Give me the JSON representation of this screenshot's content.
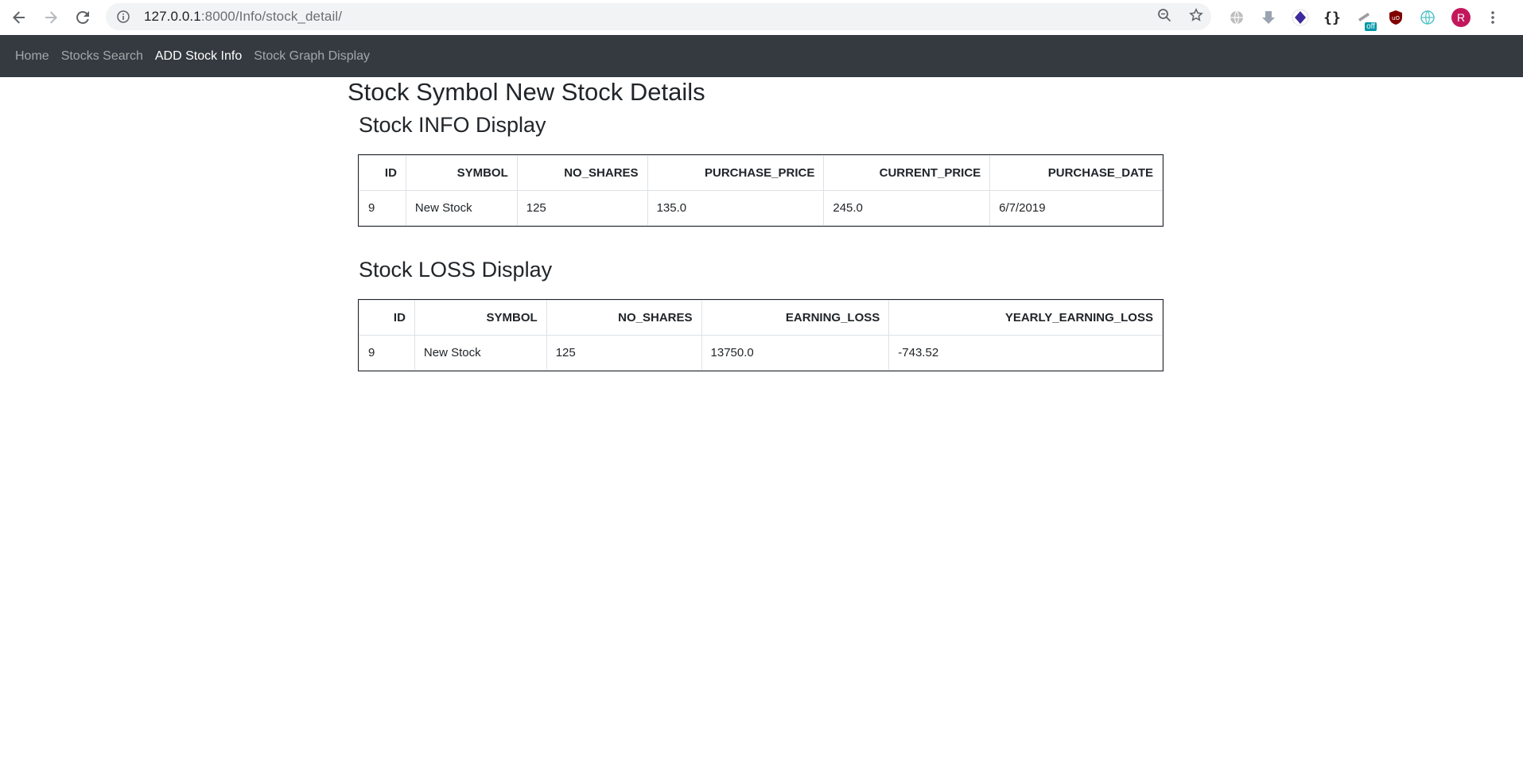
{
  "browser": {
    "url_host": "127.0.0.1",
    "url_rest": ":8000/Info/stock_detail/",
    "avatar_letter": "R",
    "extension_badge": "off"
  },
  "nav": {
    "items": [
      {
        "label": "Home",
        "active": false
      },
      {
        "label": "Stocks Search",
        "active": false
      },
      {
        "label": "ADD Stock Info",
        "active": true
      },
      {
        "label": "Stock Graph Display",
        "active": false
      }
    ]
  },
  "page": {
    "title": "Stock Symbol New Stock Details"
  },
  "info_section": {
    "title": "Stock INFO Display",
    "columns": [
      "ID",
      "SYMBOL",
      "NO_SHARES",
      "PURCHASE_PRICE",
      "CURRENT_PRICE",
      "PURCHASE_DATE"
    ],
    "rows": [
      [
        "9",
        "New Stock",
        "125",
        "135.0",
        "245.0",
        "6/7/2019"
      ]
    ]
  },
  "loss_section": {
    "title": "Stock LOSS Display",
    "columns": [
      "ID",
      "SYMBOL",
      "NO_SHARES",
      "EARNING_LOSS",
      "YEARLY_EARNING_LOSS"
    ],
    "rows": [
      [
        "9",
        "New Stock",
        "125",
        "13750.0",
        "-743.52"
      ]
    ]
  }
}
